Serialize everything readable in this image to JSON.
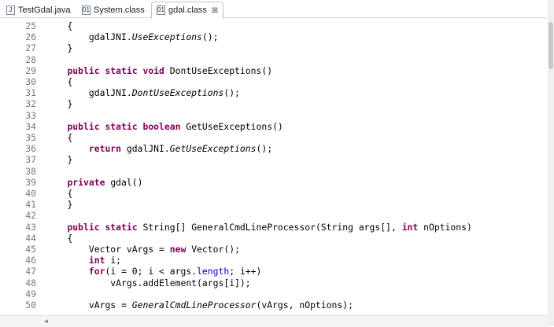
{
  "tabs": [
    {
      "label": "TestGdal.java",
      "icon": "java-file-icon"
    },
    {
      "label": "System.class",
      "icon": "class-file-icon"
    },
    {
      "label": "gdal.class",
      "icon": "class-file-icon",
      "active": true
    }
  ],
  "tab_close_glyph": "⊠",
  "lines": [
    {
      "n": "25",
      "code": "    {"
    },
    {
      "n": "26",
      "code": "        gdalJNI.UseExceptions();"
    },
    {
      "n": "27",
      "code": "    }"
    },
    {
      "n": "28",
      "code": ""
    },
    {
      "n": "29",
      "code": "    public static void DontUseExceptions()"
    },
    {
      "n": "30",
      "code": "    {"
    },
    {
      "n": "31",
      "code": "        gdalJNI.DontUseExceptions();"
    },
    {
      "n": "32",
      "code": "    }"
    },
    {
      "n": "33",
      "code": ""
    },
    {
      "n": "34",
      "code": "    public static boolean GetUseExceptions()"
    },
    {
      "n": "35",
      "code": "    {"
    },
    {
      "n": "36",
      "code": "        return gdalJNI.GetUseExceptions();"
    },
    {
      "n": "37",
      "code": "    }"
    },
    {
      "n": "38",
      "code": ""
    },
    {
      "n": "39",
      "code": "    private gdal()"
    },
    {
      "n": "40",
      "code": "    {"
    },
    {
      "n": "41",
      "code": "    }"
    },
    {
      "n": "42",
      "code": ""
    },
    {
      "n": "43",
      "code": "    public static String[] GeneralCmdLineProcessor(String args[], int nOptions)"
    },
    {
      "n": "44",
      "code": "    {"
    },
    {
      "n": "45",
      "code": "        Vector vArgs = new Vector();"
    },
    {
      "n": "46",
      "code": "        int i;"
    },
    {
      "n": "47",
      "code": "        for(i = 0; i < args.length; i++)"
    },
    {
      "n": "48",
      "code": "            vArgs.addElement(args[i]);"
    },
    {
      "n": "49",
      "code": ""
    },
    {
      "n": "50",
      "code": "        vArgs = GeneralCmdLineProcessor(vArgs, nOptions);"
    }
  ],
  "colors": {
    "keyword": "#7f0055",
    "field": "#0000c0",
    "line_number": "#787878"
  }
}
